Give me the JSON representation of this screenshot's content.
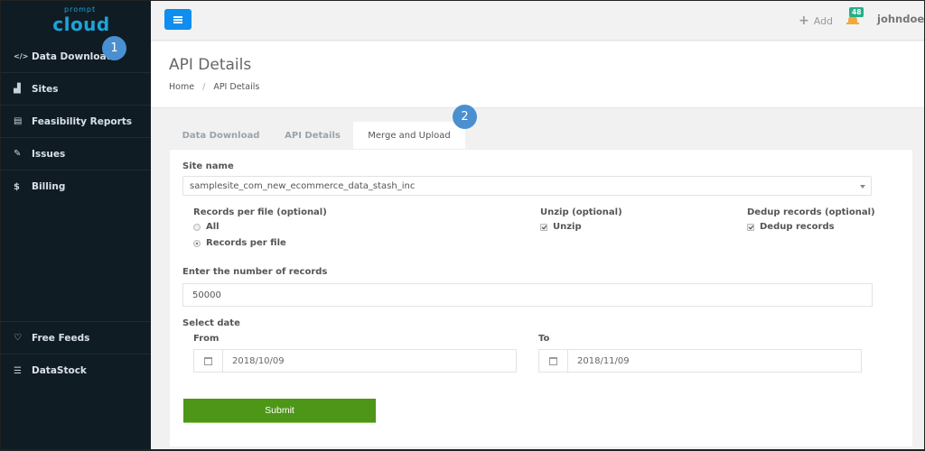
{
  "brand": {
    "logo_top": "prompt",
    "logo_main": "cloud"
  },
  "sidebar": {
    "items": [
      {
        "label": "Data Download",
        "icon": "code-icon",
        "glyph": "</>"
      },
      {
        "label": "Sites",
        "icon": "area-chart-icon",
        "glyph": "▟"
      },
      {
        "label": "Feasibility Reports",
        "icon": "file-text-icon",
        "glyph": "▤"
      },
      {
        "label": "Issues",
        "icon": "edit-icon",
        "glyph": "✎"
      },
      {
        "label": "Billing",
        "icon": "dollar-icon",
        "glyph": "$"
      }
    ],
    "bottom_items": [
      {
        "label": "Free Feeds",
        "icon": "heart-icon",
        "glyph": "♡"
      },
      {
        "label": "DataStock",
        "icon": "database-icon",
        "glyph": "☰"
      }
    ]
  },
  "callouts": {
    "one": "1",
    "two": "2"
  },
  "topbar": {
    "add_label": "Add",
    "add_glyph": "+",
    "notification_count": "48",
    "user_name": "johndoe@"
  },
  "page": {
    "title": "API Details",
    "breadcrumb": {
      "home": "Home",
      "separator": "/",
      "current": "API Details"
    }
  },
  "tabs": [
    {
      "label": "Data Download",
      "active": false
    },
    {
      "label": "API Details",
      "active": false
    },
    {
      "label": "Merge and Upload",
      "active": true
    }
  ],
  "form": {
    "site_name_label": "Site name",
    "site_name_value": "samplesite_com_new_ecommerce_data_stash_inc",
    "records_per_file_label": "Records per file (optional)",
    "records_options": [
      {
        "label": "All",
        "selected": false
      },
      {
        "label": "Records per file",
        "selected": true
      }
    ],
    "unzip_label": "Unzip (optional)",
    "unzip_option": {
      "label": "Unzip",
      "checked": true
    },
    "dedup_label": "Dedup records (optional)",
    "dedup_option": {
      "label": "Dedup records",
      "checked": true
    },
    "num_records_label": "Enter the number of records",
    "num_records_value": "50000",
    "select_date_label": "Select date",
    "from_label": "From",
    "from_value": "2018/10/09",
    "to_label": "To",
    "to_value": "2018/11/09",
    "submit_label": "Submit"
  }
}
